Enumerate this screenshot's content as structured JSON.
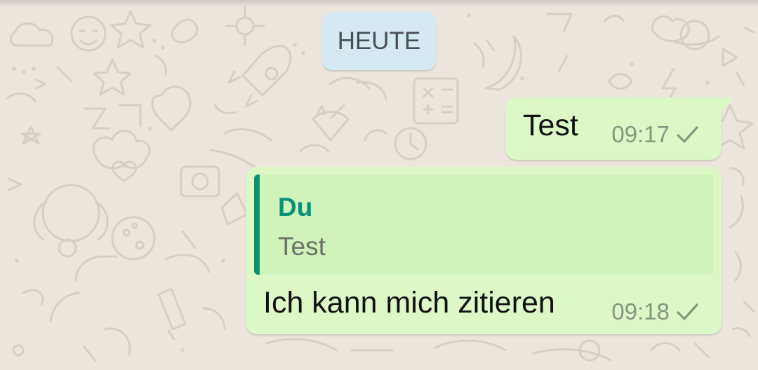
{
  "colors": {
    "wallpaper": "#ece5dd",
    "outgoing_bubble": "#dcf8c6",
    "quote_background": "#d0f2bb",
    "quote_accent": "#06916f",
    "date_chip": "#d4e9f2",
    "meta_text": "#87967f"
  },
  "date_chip": {
    "label": "HEUTE"
  },
  "messages": [
    {
      "text": "Test",
      "time": "09:17",
      "status_icon": "check-icon"
    },
    {
      "quote": {
        "author": "Du",
        "text": "Test"
      },
      "text": "Ich kann mich zitieren",
      "time": "09:18",
      "status_icon": "check-icon"
    }
  ]
}
